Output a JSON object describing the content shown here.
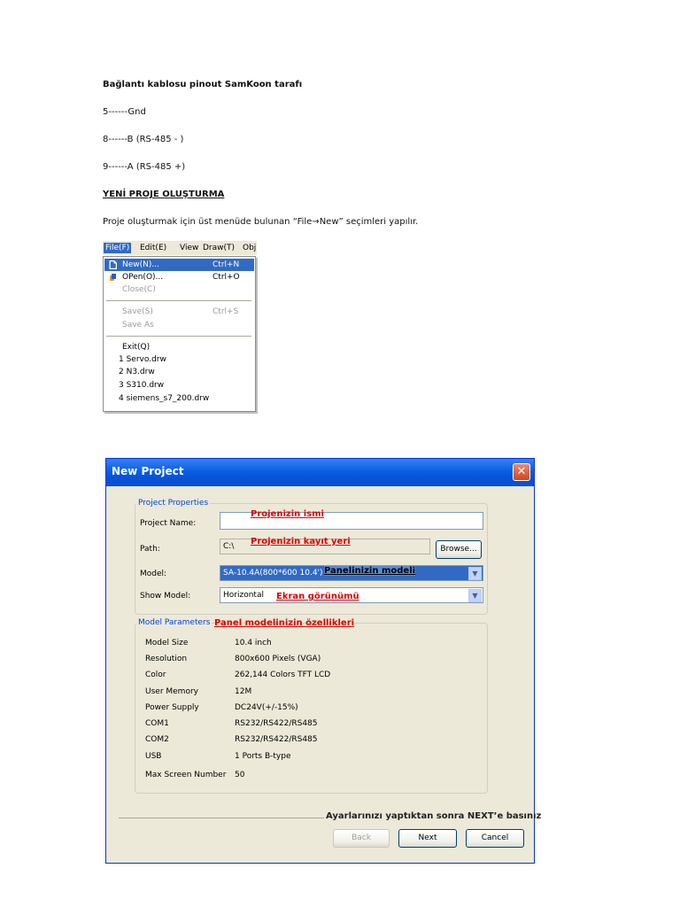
{
  "doc": {
    "heading": "Bağlantı kablosu pinout SamKoon tarafı",
    "pins": [
      "5------Gnd",
      "8------B (RS-485 - )",
      "9------A (RS-485 +)"
    ],
    "section_title": "YENİ PROJE OLUŞTURMA",
    "instruction": "Proje oluşturmak için üst menüde bulunan “File→New” seçimleri yapılır."
  },
  "menu_shot": {
    "menubar": [
      "File(F)",
      "Edit(E)",
      "View",
      "Draw(T)",
      "Obj"
    ],
    "items": [
      {
        "label": "New(N)...",
        "shortcut": "Ctrl+N"
      },
      {
        "label": "OPen(O)...",
        "shortcut": "Ctrl+O"
      },
      {
        "label": "Close(C)",
        "shortcut": ""
      },
      {
        "label": "Save(S)",
        "shortcut": "Ctrl+S"
      },
      {
        "label": "Save As",
        "shortcut": ""
      },
      {
        "label": "Exit(Q)",
        "shortcut": ""
      },
      {
        "label": "1 Servo.drw",
        "shortcut": ""
      },
      {
        "label": "2 N3.drw",
        "shortcut": ""
      },
      {
        "label": "3 S310.drw",
        "shortcut": ""
      },
      {
        "label": "4 siemens_s7_200.drw",
        "shortcut": ""
      }
    ]
  },
  "dialog": {
    "title": "New Project",
    "close_glyph": "✕",
    "project_properties": {
      "group_title": "Project Properties",
      "name_label": "Project Name:",
      "name_value": "",
      "path_label": "Path:",
      "path_value": "C:\\",
      "browse_label": "Browse...",
      "model_label": "Model:",
      "model_value": "SA-10.4A(800*600 10.4')",
      "show_model_label": "Show Model:",
      "show_model_value": "Horizontal"
    },
    "model_parameters": {
      "group_title": "Model Parameters",
      "rows": [
        {
          "label": "Model Size",
          "value": "10.4 inch"
        },
        {
          "label": "Resolution",
          "value": "800x600 Pixels (VGA)"
        },
        {
          "label": "Color",
          "value": "262,144 Colors TFT LCD"
        },
        {
          "label": "User Memory",
          "value": "12M"
        },
        {
          "label": "Power Supply",
          "value": "DC24V(+/-15%)"
        },
        {
          "label": "COM1",
          "value": "RS232/RS422/RS485"
        },
        {
          "label": "COM2",
          "value": "RS232/RS422/RS485"
        },
        {
          "label": "USB",
          "value": "1 Ports B-type"
        },
        {
          "label": "Max Screen Number",
          "value": "50"
        }
      ]
    },
    "buttons": {
      "back": "Back",
      "next": "Next",
      "cancel": "Cancel"
    },
    "annotations": {
      "project_name": "Projenizin ismi",
      "path": "Projenizin kayıt yeri",
      "model": "Panelinizin modeli",
      "show_model": "Ekran görünümü",
      "parameters": "Panel modelinizin özellikleri",
      "next_hint": "Ayarlarınızı yaptıktan sonra NEXT’e basınız"
    }
  },
  "colors": {
    "selection": "#316ac5",
    "titlebar": "#0a5ee1",
    "annotation": "#e00000",
    "group_title": "#0046d5"
  }
}
